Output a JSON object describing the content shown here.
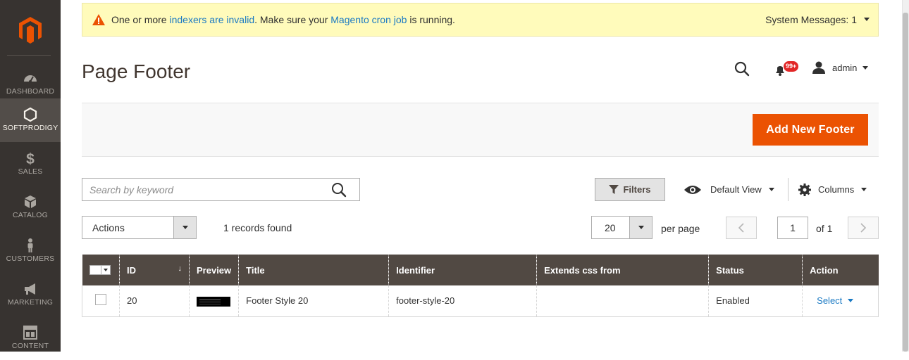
{
  "sidebar": {
    "items": [
      {
        "label": "DASHBOARD",
        "icon": "dashboard-icon"
      },
      {
        "label": "SOFTPRODIGY",
        "icon": "hexagon-icon"
      },
      {
        "label": "SALES",
        "icon": "dollar-icon"
      },
      {
        "label": "CATALOG",
        "icon": "box-icon"
      },
      {
        "label": "CUSTOMERS",
        "icon": "person-icon"
      },
      {
        "label": "MARKETING",
        "icon": "megaphone-icon"
      },
      {
        "label": "CONTENT",
        "icon": "layout-icon"
      }
    ]
  },
  "system_message": {
    "part1": "One or more ",
    "link1": "indexers are invalid",
    "part2": ". Make sure your ",
    "link2": "Magento cron job",
    "part3": " is running.",
    "count_label": "System Messages: 1"
  },
  "header": {
    "title": "Page Footer",
    "notifications_badge": "99+",
    "user": "admin"
  },
  "action_bar": {
    "add_button": "Add New Footer"
  },
  "toolbar": {
    "search_placeholder": "Search by keyword",
    "filters_label": "Filters",
    "view_label": "Default View",
    "columns_label": "Columns",
    "actions_label": "Actions",
    "records_found": "1 records found",
    "per_page_value": "20",
    "per_page_label": "per page",
    "current_page": "1",
    "of_pages": "of 1"
  },
  "grid": {
    "headers": {
      "id": "ID",
      "sort_indicator": "↓",
      "preview": "Preview",
      "title": "Title",
      "identifier": "Identifier",
      "extends": "Extends css from",
      "status": "Status",
      "action": "Action"
    },
    "rows": [
      {
        "id": "20",
        "title": "Footer Style 20",
        "identifier": "footer-style-20",
        "extends": "",
        "status": "Enabled",
        "action": "Select"
      }
    ]
  },
  "colors": {
    "sidebar_bg": "#373330",
    "sidebar_active": "#524d49",
    "accent": "#eb5202",
    "grid_header": "#514943",
    "link": "#1979c3",
    "message_bg": "#fffbbb"
  }
}
